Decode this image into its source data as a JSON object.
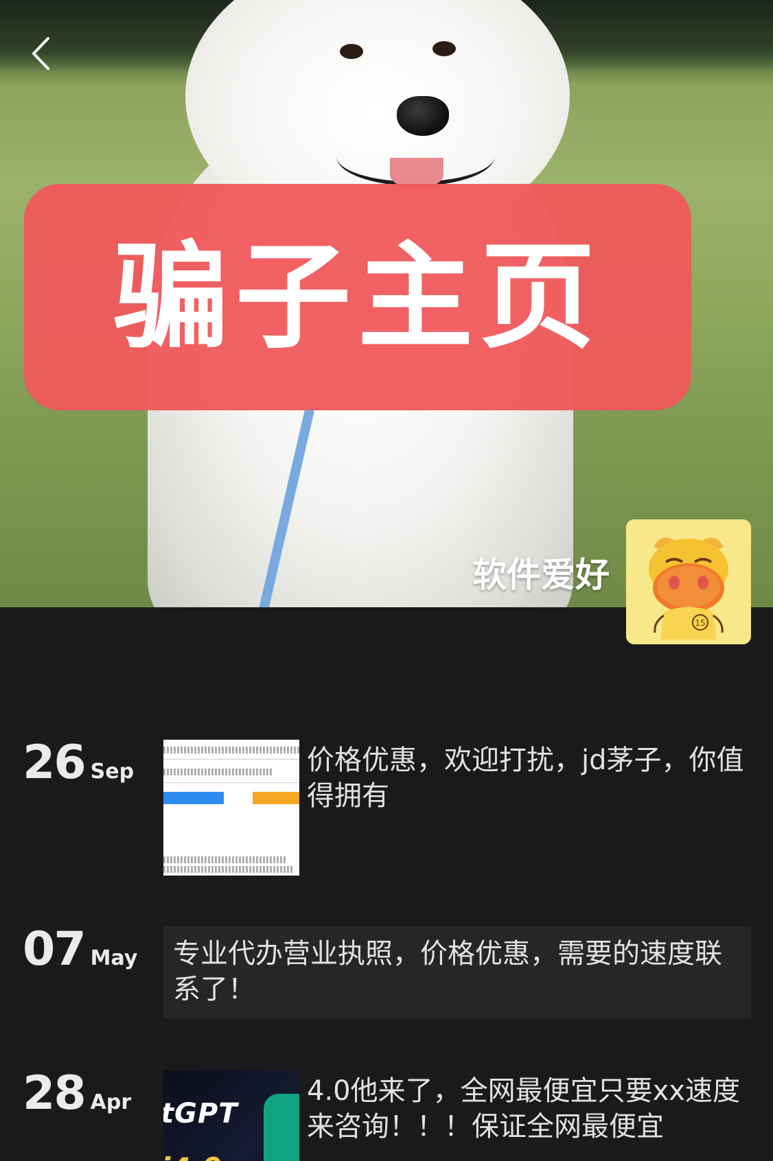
{
  "cover": {
    "banner_text": "骗子主页",
    "banner_color": "#f0585c"
  },
  "nav": {
    "back_icon": "chevron-left-icon"
  },
  "profile": {
    "name": "软件爱好",
    "avatar_icon": "cartoon-cow-avatar"
  },
  "posts": [
    {
      "day": "26",
      "month": "Sep",
      "has_image": true,
      "text": "价格优惠，欢迎打扰，jd茅子，你值得拥有"
    },
    {
      "day": "07",
      "month": "May",
      "has_image": false,
      "text": "专业代办营业执照，价格优惠，需要的速度联系了！"
    },
    {
      "day": "28",
      "month": "Apr",
      "has_image": true,
      "image_text": "tGPT",
      "image_subtext": "i4.0",
      "text": "4.0他来了，全网最便宜只要xx速度来咨询！！！保证全网最便宜"
    }
  ]
}
